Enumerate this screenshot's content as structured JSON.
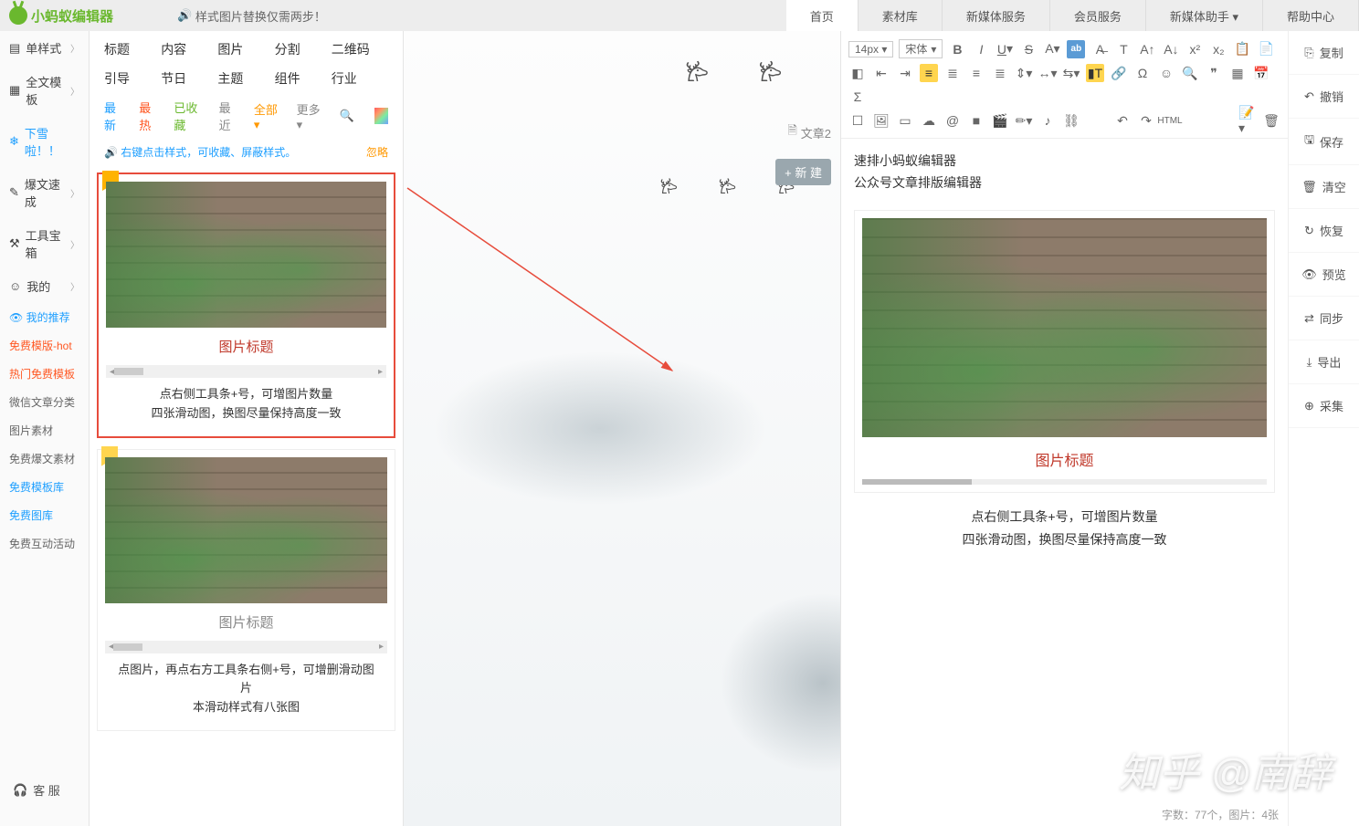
{
  "logo_text": "小蚂蚁编辑器",
  "announcement": "样式图片替换仅需两步！",
  "topnav": [
    "首页",
    "素材库",
    "新媒体服务",
    "会员服务",
    "新媒体助手 ▾",
    "帮助中心"
  ],
  "topnav_active": 0,
  "leftnav": {
    "main": [
      {
        "icon": "▤",
        "label": "单样式",
        "chev": true
      },
      {
        "icon": "▦",
        "label": "全文模板",
        "chev": true
      },
      {
        "icon": "❄",
        "label": "下雪啦！！",
        "chev": false,
        "snow": true
      },
      {
        "icon": "✎",
        "label": "爆文速成",
        "chev": true
      },
      {
        "icon": "⚒",
        "label": "工具宝箱",
        "chev": true
      },
      {
        "icon": "☺",
        "label": "我的",
        "chev": true
      }
    ],
    "subs": [
      {
        "label": "👁 我的推荐",
        "cls": "blue"
      },
      {
        "label": "免费模版-hot",
        "cls": "hot"
      },
      {
        "label": "热门免费模板",
        "cls": "hot"
      },
      {
        "label": "微信文章分类",
        "cls": ""
      },
      {
        "label": "图片素材",
        "cls": ""
      },
      {
        "label": "免费爆文素材",
        "cls": ""
      },
      {
        "label": "免费模板库",
        "cls": "link"
      },
      {
        "label": "免费图库",
        "cls": "link"
      },
      {
        "label": "免费互动活动",
        "cls": ""
      }
    ],
    "cs": "客 服"
  },
  "categories": [
    "标题",
    "内容",
    "图片",
    "分割",
    "二维码",
    "引导",
    "节日",
    "主题",
    "组件",
    "行业"
  ],
  "filters": {
    "latest": "最新",
    "hot": "最热",
    "fav": "已收藏",
    "recent": "最近",
    "all": "全部 ▾",
    "more": "更多 ▾"
  },
  "tip": "右键点击样式，可收藏、屏蔽样式。",
  "tip_ignore": "忽略",
  "cards": [
    {
      "title": "图片标题",
      "title_cls": "red",
      "desc1": "点右侧工具条+号，可增图片数量",
      "desc2": "四张滑动图，换图尽量保持高度一致",
      "selected": true,
      "bookmark": "bookmark"
    },
    {
      "title": "图片标题",
      "title_cls": "gray",
      "desc1": "点图片，再点右方工具条右侧+号，可增删滑动图片",
      "desc2": "本滑动样式有八张图",
      "selected": false,
      "bookmark": "bookmark yellow"
    }
  ],
  "doc_tab": "文章2",
  "new_btn": "+ 新 建",
  "toolbar": {
    "size": "14px ▾",
    "font": "宋体",
    "html": "HTML"
  },
  "editor_lines": [
    "速排小蚂蚁编辑器",
    "公众号文章排版编辑器"
  ],
  "editor_card": {
    "title": "图片标题",
    "desc1": "点右侧工具条+号，可增图片数量",
    "desc2": "四张滑动图，换图尽量保持高度一致"
  },
  "rightbar": [
    {
      "icon": "⎘",
      "label": "复制"
    },
    {
      "icon": "↶",
      "label": "撤销"
    },
    {
      "icon": "🖫",
      "label": "保存"
    },
    {
      "icon": "🗑",
      "label": "清空"
    },
    {
      "icon": "↻",
      "label": "恢复"
    },
    {
      "icon": "👁",
      "label": "预览"
    },
    {
      "icon": "⇄",
      "label": "同步"
    },
    {
      "icon": "⤓",
      "label": "导出"
    },
    {
      "icon": "⊕",
      "label": "采集"
    }
  ],
  "status": "字数：77个，图片：4张",
  "watermark": "知乎 @南辞"
}
